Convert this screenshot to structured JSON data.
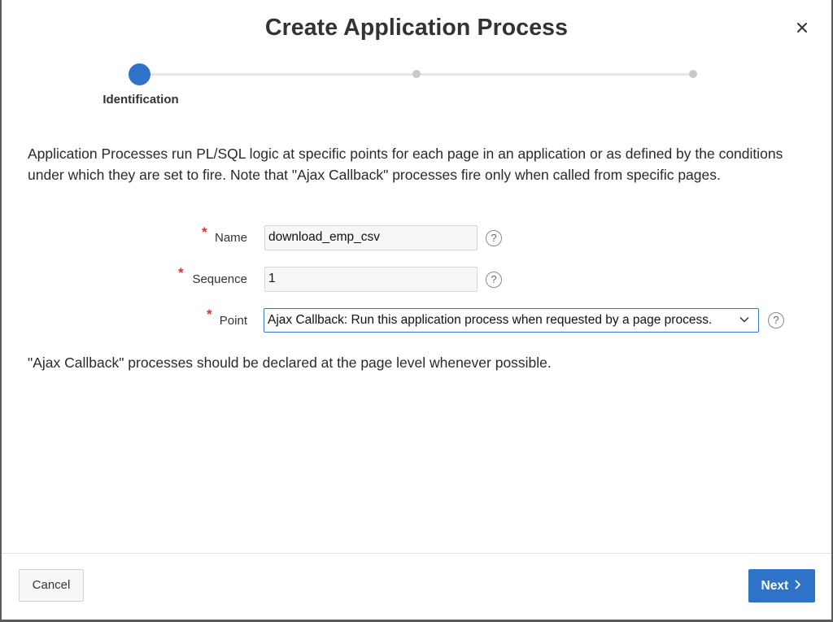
{
  "dialog": {
    "title": "Create Application Process",
    "close_icon": "close-icon"
  },
  "wizard": {
    "steps": [
      {
        "label": "Identification",
        "active": true
      },
      {
        "label": "",
        "active": false
      },
      {
        "label": "",
        "active": false
      }
    ],
    "active_color": "#2e73c8"
  },
  "description": "Application Processes run PL/SQL logic at specific points for each page in an application or as defined by the conditions under which they are set to fire. Note that \"Ajax Callback\" processes fire only when called from specific pages.",
  "form": {
    "required_marker": "*",
    "name": {
      "label": "Name",
      "value": "download_emp_csv"
    },
    "sequence": {
      "label": "Sequence",
      "value": "1"
    },
    "point": {
      "label": "Point",
      "value": "Ajax Callback: Run this application process when requested by a page process."
    },
    "help_glyph": "?"
  },
  "note": "\"Ajax Callback\" processes should be declared at the page level whenever possible.",
  "footer": {
    "cancel_label": "Cancel",
    "next_label": "Next",
    "next_color": "#2e73c8"
  }
}
